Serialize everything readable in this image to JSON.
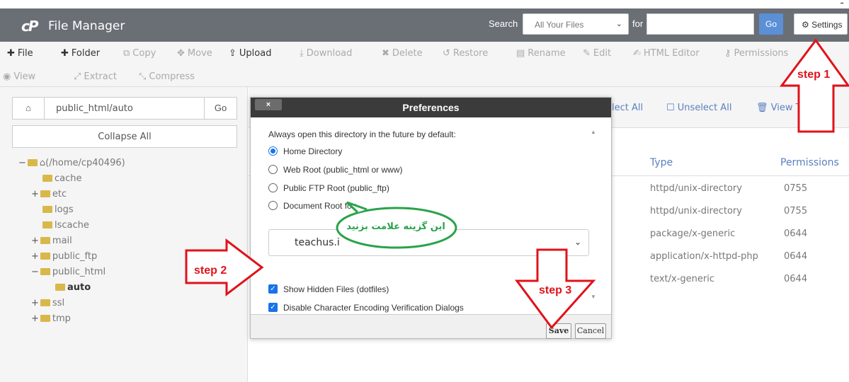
{
  "corner_glyph": "ـ",
  "header": {
    "logo": "cP",
    "title": "File Manager",
    "search_label": "Search",
    "scope_value": "All Your Files",
    "for_label": "for",
    "search_value": "",
    "go_label": "Go",
    "settings_label": "Settings"
  },
  "toolbar": {
    "items": [
      {
        "label": "File",
        "icon": "plus-icon",
        "enabled": true
      },
      {
        "label": "Folder",
        "icon": "plus-icon",
        "enabled": true
      },
      {
        "label": "Copy",
        "icon": "copy-icon",
        "enabled": false
      },
      {
        "label": "Move",
        "icon": "move-icon",
        "enabled": false
      },
      {
        "label": "Upload",
        "icon": "upload-icon",
        "enabled": true
      },
      {
        "label": "Download",
        "icon": "download-icon",
        "enabled": false
      },
      {
        "label": "Delete",
        "icon": "delete-icon",
        "enabled": false
      },
      {
        "label": "Restore",
        "icon": "restore-icon",
        "enabled": false
      },
      {
        "label": "Rename",
        "icon": "rename-icon",
        "enabled": false
      },
      {
        "label": "Edit",
        "icon": "pencil-icon",
        "enabled": false
      },
      {
        "label": "HTML Editor",
        "icon": "html-editor-icon",
        "enabled": false
      },
      {
        "label": "Permissions",
        "icon": "key-icon",
        "enabled": false
      },
      {
        "label": "View",
        "icon": "eye-icon",
        "enabled": false
      },
      {
        "label": "Extract",
        "icon": "extract-icon",
        "enabled": false
      },
      {
        "label": "Compress",
        "icon": "compress-icon",
        "enabled": false
      }
    ]
  },
  "left": {
    "path_value": "public_html/auto",
    "go_label": "Go",
    "collapse_label": "Collapse All",
    "tree": [
      {
        "label": "(/home/cp40496)",
        "toggle": "−",
        "level": 0,
        "home": true
      },
      {
        "label": "cache",
        "toggle": "",
        "level": 1
      },
      {
        "label": "etc",
        "toggle": "+",
        "level": 1
      },
      {
        "label": "logs",
        "toggle": "",
        "level": 1
      },
      {
        "label": "lscache",
        "toggle": "",
        "level": 1
      },
      {
        "label": "mail",
        "toggle": "+",
        "level": 1
      },
      {
        "label": "public_ftp",
        "toggle": "+",
        "level": 1
      },
      {
        "label": "public_html",
        "toggle": "−",
        "level": 1
      },
      {
        "label": "auto",
        "toggle": "",
        "level": 2,
        "selected": true
      },
      {
        "label": "ssl",
        "toggle": "+",
        "level": 1
      },
      {
        "label": "tmp",
        "toggle": "+",
        "level": 1
      }
    ]
  },
  "right": {
    "select_all": "elect All",
    "unselect_all": "Unselect All",
    "view_trash": "View Trash",
    "col_type": "Type",
    "col_perm": "Permissions",
    "rows": [
      {
        "type": "httpd/unix-directory",
        "perm": "0755"
      },
      {
        "type": "httpd/unix-directory",
        "perm": "0755"
      },
      {
        "type": "package/x-generic",
        "perm": "0644"
      },
      {
        "type": "application/x-httpd-php",
        "perm": "0644"
      },
      {
        "type": "text/x-generic",
        "perm": "0644"
      }
    ]
  },
  "dialog": {
    "title": "Preferences",
    "close_label": "×",
    "intro": "Always open this directory in the future by default:",
    "options": [
      {
        "label": "Home Directory",
        "checked": true
      },
      {
        "label": "Web Root (public_html or www)",
        "checked": false
      },
      {
        "label": "Public FTP Root (public_ftp)",
        "checked": false
      },
      {
        "label": "Document Root for:",
        "checked": false
      }
    ],
    "docroot_value": "teachus.i",
    "show_hidden": "Show Hidden Files (dotfiles)",
    "disable_enc": "Disable Character Encoding Verification Dialogs",
    "save": "Save",
    "cancel": "Cancel"
  },
  "annotations": {
    "step1": "step 1",
    "step2": "step 2",
    "step3": "step 3",
    "bubble": "این گزینه علامت بزنید",
    "color": "#e0121a",
    "bubble_color": "#2aa24a"
  }
}
